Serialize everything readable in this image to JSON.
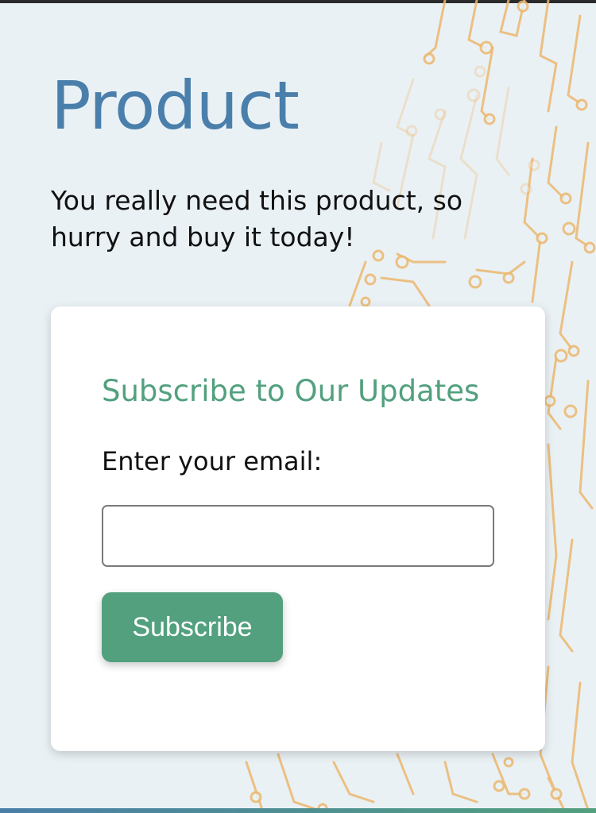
{
  "header": {
    "title": "Product"
  },
  "hero": {
    "tagline": "You really need this product, so hurry and buy it today!"
  },
  "subscribe": {
    "heading": "Subscribe to Our Updates",
    "email_label": "Enter your email:",
    "email_value": "",
    "email_placeholder": "",
    "button_label": "Subscribe"
  },
  "colors": {
    "background": "#eaf1f5",
    "title": "#4a7fab",
    "accent_green": "#52a07e",
    "circuit_gold": "#e8b76e"
  },
  "decoration": {
    "icon": "circuit-board-pattern"
  }
}
